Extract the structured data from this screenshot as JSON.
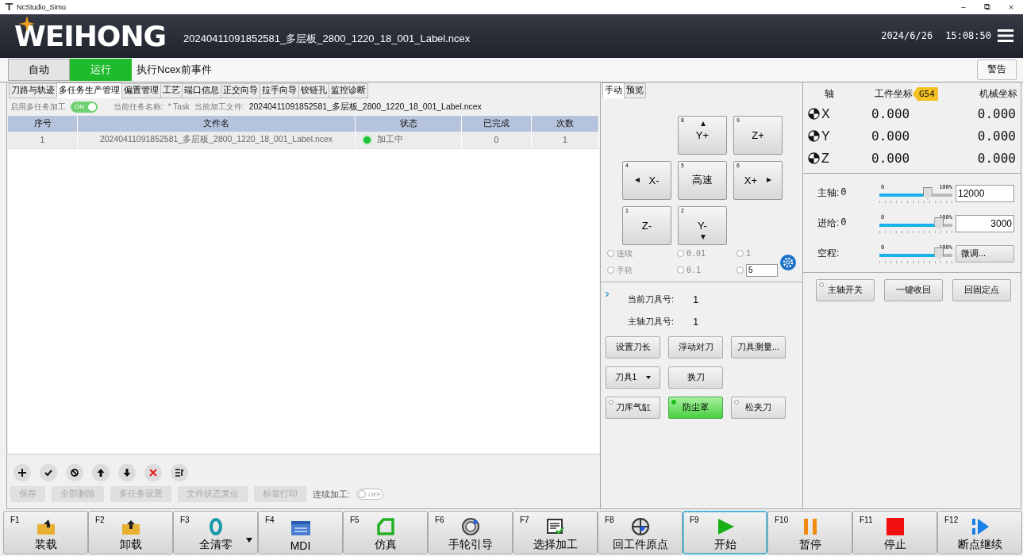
{
  "window": {
    "title": "NcStudio_Simu",
    "controls": [
      "−",
      "⧉",
      "×"
    ]
  },
  "header": {
    "logo": "WEIHONG",
    "file": "20240411091852581_多层板_2800_1220_18_001_Label.ncex",
    "date": "2024/6/26",
    "time": "15:08:50"
  },
  "status_bar": {
    "modes": [
      {
        "label": "自动",
        "selected": false
      },
      {
        "label": "运行",
        "selected": true
      }
    ],
    "message": "执行Ncex前事件",
    "alarm_button": "警告"
  },
  "left_panel": {
    "tabs": [
      {
        "label": "刀路与轨迹",
        "selected": false
      },
      {
        "label": "多任务生产管理",
        "selected": true
      },
      {
        "label": "偏置管理",
        "selected": false
      },
      {
        "label": "工艺",
        "selected": false
      },
      {
        "label": "端口信息",
        "selected": false
      },
      {
        "label": "正交向导",
        "selected": false
      },
      {
        "label": "拉手向导",
        "selected": false
      },
      {
        "label": "铰链孔",
        "selected": false
      },
      {
        "label": "监控诊断",
        "selected": false
      }
    ],
    "enable_label": "启用多任务加工",
    "enable_toggle": {
      "on": true,
      "text": "ON"
    },
    "task_label": "当前任务名称:",
    "task_name": "* Task",
    "file_label": "当前加工文件:",
    "file_name": "20240411091852581_多层板_2800_1220_18_001_Label.ncex",
    "table": {
      "columns": [
        "序号",
        "文件名",
        "状态",
        "已完成",
        "次数"
      ],
      "rows": [
        {
          "cells": [
            "1",
            "20240411091852581_多层板_2800_1220_18_001_Label.ncex",
            "加工中",
            "0",
            "1"
          ],
          "color": "#22c03a"
        }
      ]
    },
    "buttons": [
      {
        "label": "保存",
        "disabled": true
      },
      {
        "label": "全部删除",
        "disabled": true
      },
      {
        "label": "多任务设置",
        "disabled": true
      },
      {
        "label": "文件状态复位",
        "disabled": true
      },
      {
        "label": "标签打印",
        "disabled": true
      }
    ],
    "continuous_label": "连续加工:",
    "continuous_toggle": {
      "on": false,
      "text": "OFF"
    }
  },
  "manual_panel": {
    "tabs": [
      {
        "label": "手动",
        "selected": true
      },
      {
        "label": "预览",
        "selected": false
      }
    ],
    "jog": [
      {
        "key": "8",
        "label": "Y+",
        "kind": "up"
      },
      {
        "key": "9",
        "label": "Z+",
        "kind": "plain"
      },
      {
        "key": "4",
        "label": "X-",
        "kind": "left"
      },
      {
        "key": "5",
        "label": "高速",
        "kind": "plain"
      },
      {
        "key": "6",
        "label": "X+",
        "kind": "right"
      },
      {
        "key": "1",
        "label": "Z-",
        "kind": "plain"
      },
      {
        "key": "2",
        "label": "Y-",
        "kind": "down"
      }
    ],
    "steps": [
      {
        "label": "连续",
        "selected": false
      },
      {
        "label": "0.01",
        "selected": false
      },
      {
        "label": "1",
        "selected": false
      },
      {
        "label": "手轮",
        "selected": false
      },
      {
        "label": "0.1",
        "selected": false
      },
      {
        "value": "5",
        "selected": false
      }
    ],
    "current_tool_label": "当前刀具号:",
    "current_tool": "1",
    "spindle_tool_label": "主轴刀具号:",
    "spindle_tool": "1",
    "tool_buttons": [
      {
        "label": "设置刀长",
        "kind": "button"
      },
      {
        "label": "浮动对刀",
        "kind": "button"
      },
      {
        "label": "刀具测量...",
        "kind": "button"
      },
      {
        "label": "刀具1",
        "kind": "dropdown"
      },
      {
        "label": "换刀",
        "kind": "button"
      }
    ],
    "io_buttons": [
      {
        "label": "刀库气缸",
        "on": false
      },
      {
        "label": "防尘罩",
        "on": true
      },
      {
        "label": "松夹刀",
        "on": false
      }
    ]
  },
  "coords": {
    "columns": [
      "轴",
      "工件坐标",
      "机械坐标"
    ],
    "wcs": "G54",
    "rows": [
      {
        "axis": "X",
        "work": "0.000",
        "machine": "0.000"
      },
      {
        "axis": "Y",
        "work": "0.000",
        "machine": "0.000"
      },
      {
        "axis": "Z",
        "work": "0.000",
        "machine": "0.000"
      }
    ]
  },
  "overrides": [
    {
      "label": "主轴:",
      "reading": "0",
      "min": "0",
      "max": "100%",
      "level": 0.66,
      "kind": "input",
      "value": "12000"
    },
    {
      "label": "进给:",
      "reading": "0",
      "min": "0",
      "max": "100%",
      "level": 0.82,
      "kind": "input",
      "value": "3000"
    },
    {
      "label": "空程:",
      "min": "0",
      "max": "100%",
      "level": 0.82,
      "kind": "button",
      "value": "微调..."
    }
  ],
  "spindle_buttons": [
    {
      "label": "主轴开关",
      "on": false
    },
    {
      "label": "一键收回"
    },
    {
      "label": "回固定点"
    }
  ],
  "function_keys": [
    {
      "key": "F1",
      "label": "装载",
      "kind": "load",
      "focused": false
    },
    {
      "key": "F2",
      "label": "卸载",
      "kind": "unload",
      "focused": false
    },
    {
      "key": "F3",
      "label": "全清零",
      "kind": "zero",
      "focused": false,
      "dropdown": true
    },
    {
      "key": "F4",
      "label": "MDI",
      "kind": "mdi",
      "focused": false
    },
    {
      "key": "F5",
      "label": "仿真",
      "kind": "sim",
      "focused": false
    },
    {
      "key": "F6",
      "label": "手轮引导",
      "kind": "wheel",
      "focused": false
    },
    {
      "key": "F7",
      "label": "选择加工",
      "kind": "select",
      "focused": false
    },
    {
      "key": "F8",
      "label": "回工件原点",
      "kind": "origin",
      "focused": false
    },
    {
      "key": "F9",
      "label": "开始",
      "kind": "start",
      "focused": true
    },
    {
      "key": "F10",
      "label": "暂停",
      "kind": "pause",
      "focused": false
    },
    {
      "key": "F11",
      "label": "停止",
      "kind": "stop",
      "focused": false
    },
    {
      "key": "F12",
      "label": "断点继续",
      "kind": "resume",
      "focused": false
    }
  ]
}
